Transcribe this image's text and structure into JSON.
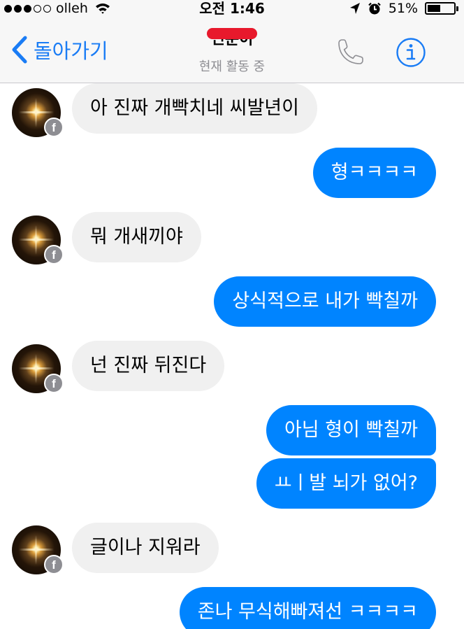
{
  "status_bar": {
    "carrier": "olleh",
    "time": "오전 1:46",
    "battery": "51%",
    "battery_level": 0.51,
    "signal_dots_filled": 3,
    "signal_dots_total": 5,
    "icons": [
      "wifi-icon",
      "location-arrow-icon",
      "alarm-clock-icon",
      "battery-icon"
    ]
  },
  "nav": {
    "back_label": "돌아가기",
    "contact_name": "민준이",
    "subtitle": "현재 활동 중",
    "icons": [
      "chevron-left-icon",
      "phone-icon",
      "info-icon"
    ]
  },
  "messages": [
    {
      "direction": "in",
      "text": "아 진짜 개빡치네 씨발년이"
    },
    {
      "direction": "out",
      "text": "형ㅋㅋㅋㅋ"
    },
    {
      "direction": "in",
      "text": "뭐 개새끼야"
    },
    {
      "direction": "out",
      "text": "상식적으로 내가 빡칠까"
    },
    {
      "direction": "in",
      "text": "넌 진짜 뒤진다"
    },
    {
      "direction": "out",
      "text": "아님 형이 빡칠까"
    },
    {
      "direction": "out",
      "text": "ㅛㅣ발 뇌가 없어?"
    },
    {
      "direction": "in",
      "text": "글이나 지워라"
    },
    {
      "direction": "out",
      "text": "존나 무식해빠져선 ㅋㅋㅋㅋ"
    }
  ],
  "avatar_badge": "f",
  "colors": {
    "accent": "#1a7cf5",
    "outgoing_bubble": "#0084ff",
    "incoming_bubble": "#f0f0f0",
    "bar_background": "#f7f7f7"
  }
}
